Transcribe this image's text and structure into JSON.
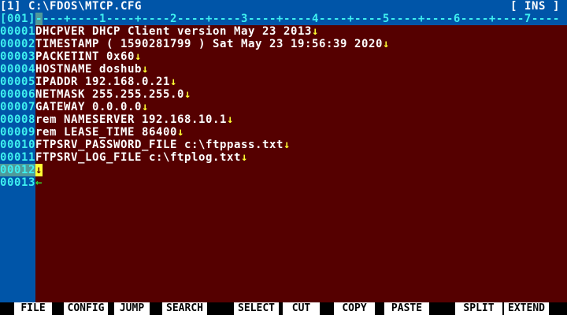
{
  "title": "[1] C:\\FDOS\\MTCP.CFG",
  "mode": "[ INS ]",
  "ruler": {
    "column": "[001]",
    "scale": "----+----1----+----2----+----3----+----4----+----5----+----6----+----7----"
  },
  "lines": [
    {
      "num": "00001",
      "text": "DHCPVER DHCP Client version May 23 2013"
    },
    {
      "num": "00002",
      "text": "TIMESTAMP ( 1590281799 ) Sat May 23 19:56:39 2020"
    },
    {
      "num": "00003",
      "text": "PACKETINT 0x60"
    },
    {
      "num": "00004",
      "text": "HOSTNAME doshub"
    },
    {
      "num": "00005",
      "text": "IPADDR 192.168.0.21"
    },
    {
      "num": "00006",
      "text": "NETMASK 255.255.255.0"
    },
    {
      "num": "00007",
      "text": "GATEWAY 0.0.0.0"
    },
    {
      "num": "00008",
      "text": "rem NAMESERVER 192.168.10.1"
    },
    {
      "num": "00009",
      "text": "rem LEASE_TIME 86400"
    },
    {
      "num": "00010",
      "text": "FTPSRV_PASSWORD_FILE c:\\ftppass.txt"
    },
    {
      "num": "00011",
      "text": "FTPSRV_LOG_FILE c:\\ftplog.txt"
    },
    {
      "num": "00012",
      "text": ""
    },
    {
      "num": "00013",
      "text": ""
    }
  ],
  "eol_mark": "↓",
  "eof_mark": "←",
  "fkeys": [
    "FILE",
    "CONFIG",
    "JUMP",
    "SEARCH",
    "SELECT",
    "CUT",
    "COPY",
    "PASTE",
    "SPLIT",
    "EXTEND"
  ]
}
